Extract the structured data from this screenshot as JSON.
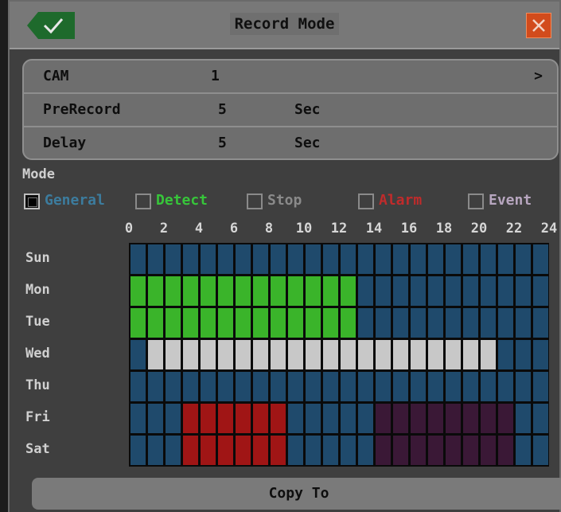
{
  "dialog": {
    "title": "Record Mode",
    "ok_icon": "checkmark-icon",
    "close_icon": "close-icon"
  },
  "settings": {
    "cam": {
      "label": "CAM",
      "value": "1",
      "chevron": ">"
    },
    "prerecord": {
      "label": "PreRecord",
      "value": "5",
      "unit": "Sec"
    },
    "delay": {
      "label": "Delay",
      "value": "5",
      "unit": "Sec"
    }
  },
  "mode": {
    "label": "Mode",
    "options": [
      {
        "label": "General",
        "color": "#3c7c9e",
        "checked": true
      },
      {
        "label": "Detect",
        "color": "#37c53a",
        "checked": false
      },
      {
        "label": "Stop",
        "color": "#8a8a8a",
        "checked": false
      },
      {
        "label": "Alarm",
        "color": "#c02b2b",
        "checked": false
      },
      {
        "label": "Event",
        "color": "#b7a6bf",
        "checked": false
      }
    ]
  },
  "schedule": {
    "hour_labels": [
      "0",
      "2",
      "4",
      "6",
      "8",
      "10",
      "12",
      "14",
      "16",
      "18",
      "20",
      "22",
      "24"
    ],
    "days": [
      "Sun",
      "Mon",
      "Tue",
      "Wed",
      "Thu",
      "Fri",
      "Sat"
    ],
    "mode_colors": {
      "General": "#1f4a6c",
      "Detect": "#3ab42a",
      "Stop": "#c8c8c8",
      "Alarm": "#a01515",
      "Event": "#3a1836"
    },
    "rows": [
      [
        "General",
        "General",
        "General",
        "General",
        "General",
        "General",
        "General",
        "General",
        "General",
        "General",
        "General",
        "General",
        "General",
        "General",
        "General",
        "General",
        "General",
        "General",
        "General",
        "General",
        "General",
        "General",
        "General",
        "General"
      ],
      [
        "Detect",
        "Detect",
        "Detect",
        "Detect",
        "Detect",
        "Detect",
        "Detect",
        "Detect",
        "Detect",
        "Detect",
        "Detect",
        "Detect",
        "Detect",
        "General",
        "General",
        "General",
        "General",
        "General",
        "General",
        "General",
        "General",
        "General",
        "General",
        "General"
      ],
      [
        "Detect",
        "Detect",
        "Detect",
        "Detect",
        "Detect",
        "Detect",
        "Detect",
        "Detect",
        "Detect",
        "Detect",
        "Detect",
        "Detect",
        "Detect",
        "General",
        "General",
        "General",
        "General",
        "General",
        "General",
        "General",
        "General",
        "General",
        "General",
        "General"
      ],
      [
        "General",
        "Stop",
        "Stop",
        "Stop",
        "Stop",
        "Stop",
        "Stop",
        "Stop",
        "Stop",
        "Stop",
        "Stop",
        "Stop",
        "Stop",
        "Stop",
        "Stop",
        "Stop",
        "Stop",
        "Stop",
        "Stop",
        "Stop",
        "Stop",
        "General",
        "General",
        "General"
      ],
      [
        "General",
        "General",
        "General",
        "General",
        "General",
        "General",
        "General",
        "General",
        "General",
        "General",
        "General",
        "General",
        "General",
        "General",
        "General",
        "General",
        "General",
        "General",
        "General",
        "General",
        "General",
        "General",
        "General",
        "General"
      ],
      [
        "General",
        "General",
        "General",
        "Alarm",
        "Alarm",
        "Alarm",
        "Alarm",
        "Alarm",
        "Alarm",
        "General",
        "General",
        "General",
        "General",
        "General",
        "Event",
        "Event",
        "Event",
        "Event",
        "Event",
        "Event",
        "Event",
        "Event",
        "General",
        "General"
      ],
      [
        "General",
        "General",
        "General",
        "Alarm",
        "Alarm",
        "Alarm",
        "Alarm",
        "Alarm",
        "Alarm",
        "General",
        "General",
        "General",
        "General",
        "General",
        "Event",
        "Event",
        "Event",
        "Event",
        "Event",
        "Event",
        "Event",
        "Event",
        "General",
        "General"
      ]
    ]
  },
  "copy_button": {
    "label": "Copy To"
  }
}
